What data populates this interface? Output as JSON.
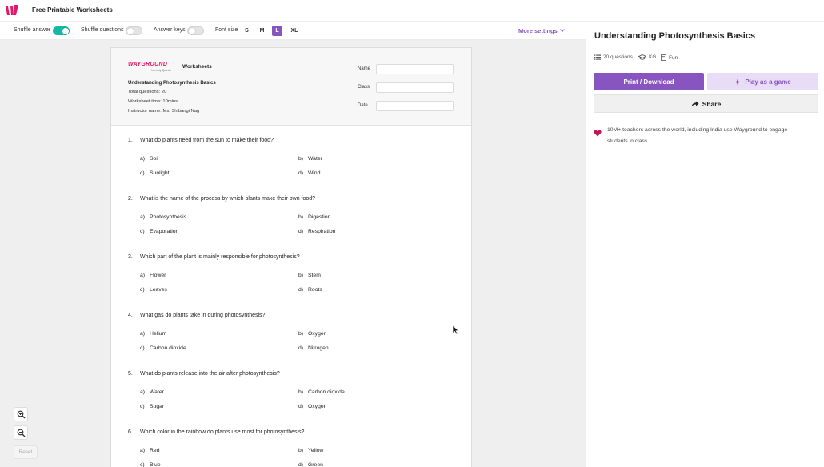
{
  "app": {
    "title": "Free Printable Worksheets"
  },
  "colors": {
    "accent": "#8854c0",
    "toggle_on": "#14b8a6",
    "brand": "#e0196b"
  },
  "settings": {
    "shuffle_answer": {
      "label": "Shuffle answer",
      "on": true
    },
    "shuffle_questions": {
      "label": "Shuffle questions",
      "on": false
    },
    "answer_keys": {
      "label": "Answer keys",
      "on": false
    },
    "font_size": {
      "label": "Font size",
      "options": [
        "S",
        "M",
        "L",
        "XL"
      ],
      "selected": "L"
    },
    "more_label": "More settings"
  },
  "worksheet": {
    "brand": "WAYGROUND",
    "brand_sub": "formerly Quizizz",
    "label": "Worksheets",
    "title": "Understanding Photosynthesis Basics",
    "total_questions": "Total questions: 20",
    "time": "Worksheet time: 10mins",
    "instructor": "Instructor name: Ms. Shibangi Nag",
    "fields": [
      "Name",
      "Class",
      "Date"
    ],
    "questions": [
      {
        "num": "1.",
        "text": "What do plants need from the sun to make their food?",
        "options": [
          [
            "a)",
            "Soil"
          ],
          [
            "b)",
            "Water"
          ],
          [
            "c)",
            "Sunlight"
          ],
          [
            "d)",
            "Wind"
          ]
        ]
      },
      {
        "num": "2.",
        "text": "What is the name of the process by which plants make their own food?",
        "options": [
          [
            "a)",
            "Photosynthesis"
          ],
          [
            "b)",
            "Digestion"
          ],
          [
            "c)",
            "Evaporation"
          ],
          [
            "d)",
            "Respiration"
          ]
        ]
      },
      {
        "num": "3.",
        "text": "Which part of the plant is mainly responsible for photosynthesis?",
        "options": [
          [
            "a)",
            "Flower"
          ],
          [
            "b)",
            "Stem"
          ],
          [
            "c)",
            "Leaves"
          ],
          [
            "d)",
            "Roots"
          ]
        ]
      },
      {
        "num": "4.",
        "text": "What gas do plants take in during photosynthesis?",
        "options": [
          [
            "a)",
            "Helium"
          ],
          [
            "b)",
            "Oxygen"
          ],
          [
            "c)",
            "Carbon dioxide"
          ],
          [
            "d)",
            "Nitrogen"
          ]
        ]
      },
      {
        "num": "5.",
        "text": "What do plants release into the air after photosynthesis?",
        "options": [
          [
            "a)",
            "Water"
          ],
          [
            "b)",
            "Carbon dioxide"
          ],
          [
            "c)",
            "Sugar"
          ],
          [
            "d)",
            "Oxygen"
          ]
        ]
      },
      {
        "num": "6.",
        "text": "Which color in the rainbow do plants use most for photosynthesis?",
        "options": [
          [
            "a)",
            "Red"
          ],
          [
            "b)",
            "Yellow"
          ],
          [
            "c)",
            "Blue"
          ],
          [
            "d)",
            "Green"
          ]
        ]
      }
    ]
  },
  "zoom": {
    "reset_label": "Reset"
  },
  "panel": {
    "title": "Understanding Photosynthesis Basics",
    "questions_count": "20 questions",
    "grade": "KG",
    "tag": "Fun",
    "print_label": "Print / Download",
    "play_label": "Play as a game",
    "share_label": "Share",
    "promo_text": "10M+ teachers across the world, including India use Wayground to engage students in class"
  }
}
